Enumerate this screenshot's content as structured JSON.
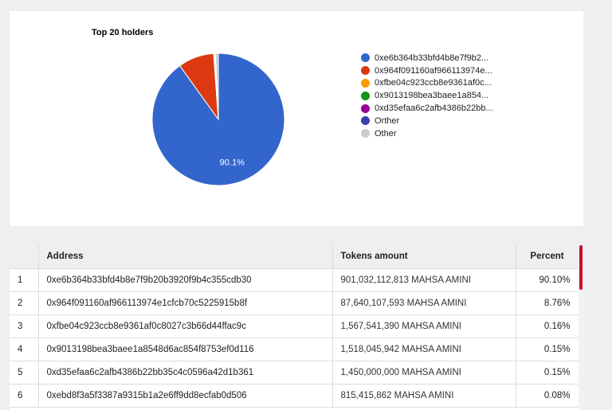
{
  "chart_data": {
    "type": "pie",
    "title": "Top 20 holders",
    "series": [
      {
        "name": "0xe6b364b33bfd4b8e7f9b2...",
        "value": 90.1,
        "color": "#3366cc"
      },
      {
        "name": "0x964f091160af966113974e...",
        "value": 8.76,
        "color": "#dc3912"
      },
      {
        "name": "0xfbe04c923ccb8e9361af0c...",
        "value": 0.16,
        "color": "#ff9900"
      },
      {
        "name": "0x9013198bea3baee1a854...",
        "value": 0.15,
        "color": "#109618"
      },
      {
        "name": "0xd35efaa6c2afb4386b22bb...",
        "value": 0.15,
        "color": "#990099"
      },
      {
        "name": "Orther",
        "value": 0.0,
        "color": "#3b3eac"
      },
      {
        "name": "Other",
        "value": 0.68,
        "color": "#cccccc"
      }
    ],
    "data_labels": [
      "90.1%"
    ]
  },
  "table": {
    "headers": [
      "",
      "Address",
      "Tokens amount",
      "Percent"
    ],
    "rows": [
      [
        "1",
        "0xe6b364b33bfd4b8e7f9b20b3920f9b4c355cdb30",
        "901,032,112,813 MAHSA AMINI",
        "90.10%"
      ],
      [
        "2",
        "0x964f091160af966113974e1cfcb70c5225915b8f",
        "87,640,107,593 MAHSA AMINI",
        "8.76%"
      ],
      [
        "3",
        "0xfbe04c923ccb8e9361af0c8027c3b66d44ffac9c",
        "1,567,541,390 MAHSA AMINI",
        "0.16%"
      ],
      [
        "4",
        "0x9013198bea3baee1a8548d6ac854f8753ef0d116",
        "1,518,045,942 MAHSA AMINI",
        "0.15%"
      ],
      [
        "5",
        "0xd35efaa6c2afb4386b22bb35c4c0596a42d1b361",
        "1,450,000,000 MAHSA AMINI",
        "0.15%"
      ],
      [
        "6",
        "0xebd8f3a5f3387a9315b1a2e6ff9dd8ecfab0d506",
        "815,415,862 MAHSA AMINI",
        "0.08%"
      ]
    ]
  },
  "colors": {
    "scroll_thumb": "#c8102e"
  }
}
